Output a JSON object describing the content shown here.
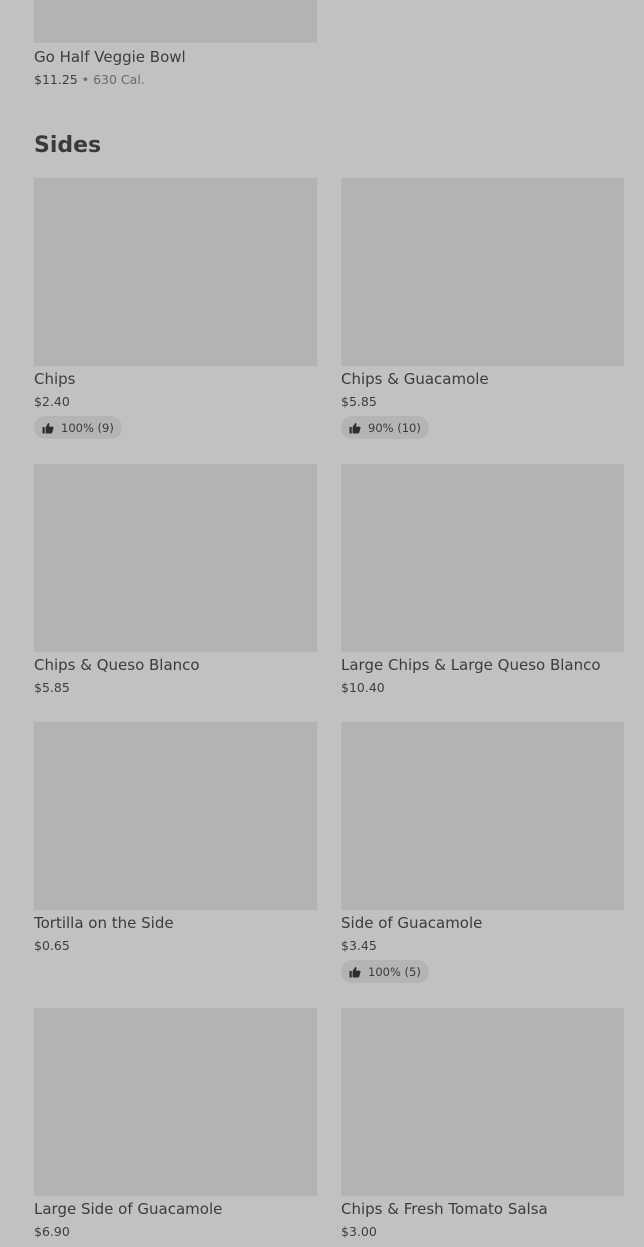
{
  "previous_item": {
    "name": "Go Half Veggie Bowl",
    "price": "$11.25",
    "separator": "•",
    "calories": "630 Cal."
  },
  "section": {
    "title": "Sides"
  },
  "items": [
    {
      "name": "Chips",
      "price": "$2.40",
      "rating": "100% (9)"
    },
    {
      "name": "Chips & Guacamole",
      "price": "$5.85",
      "rating": "90% (10)"
    },
    {
      "name": "Chips & Queso Blanco",
      "price": "$5.85"
    },
    {
      "name": "Large Chips & Large Queso Blanco",
      "price": "$10.40"
    },
    {
      "name": "Tortilla on the Side",
      "price": "$0.65"
    },
    {
      "name": "Side of Guacamole",
      "price": "$3.45",
      "rating": "100% (5)"
    },
    {
      "name": "Large Side of Guacamole",
      "price": "$6.90"
    },
    {
      "name": "Chips & Fresh Tomato Salsa",
      "price": "$3.00"
    }
  ],
  "icons": {
    "rating": "thumbs-up-icon"
  }
}
